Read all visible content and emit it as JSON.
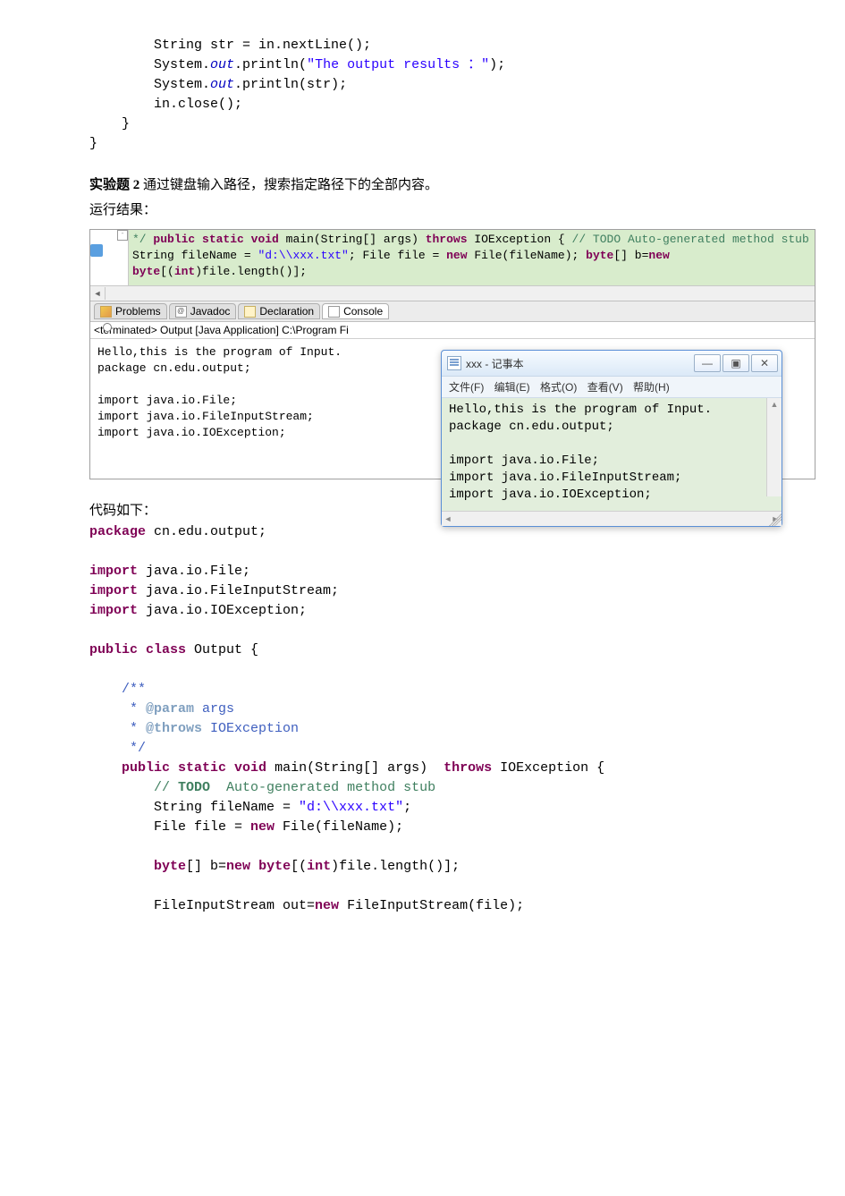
{
  "codeTop": {
    "l1a": "        String str = in.nextLine();",
    "l2a": "        System.",
    "l2b": "out",
    "l2c": ".println(",
    "l2d": "\"The output results ：\"",
    "l2e": ");",
    "l3a": "        System.",
    "l3b": "out",
    "l3c": ".println(str);",
    "l4": "        in.close();",
    "l5": "    }",
    "l6": "}"
  },
  "prose1_bold": "实验题 2",
  "prose1_rest": "  通过键盘输入路径，搜索指定路径下的全部内容。",
  "prose2": "运行结果：",
  "editor": {
    "l0": "         */",
    "l1a": "        ",
    "l1b": "public static void",
    "l1c": " main(String[] args) ",
    "l1d": "throws",
    "l1e": " IOException {",
    "l2a": "            ",
    "l2b": "// TODO Auto-generated method stub",
    "l3a": "            String fileName = ",
    "l3b": "\"d:\\\\xxx.txt\"",
    "l3c": ";",
    "l4a": "            File file = ",
    "l4b": "new",
    "l4c": " File(fileName);",
    "l5": "",
    "l6a": "            ",
    "l6b": "byte",
    "l6c": "[] b=",
    "l6d": "new byte",
    "l6e": "[(",
    "l6f": "int",
    "l6g": ")file.length()];"
  },
  "tabs": {
    "problems": "Problems",
    "javadoc": "Javadoc",
    "declaration": "Declaration",
    "console": "Console"
  },
  "terminated": "<terminated> Output [Java Application] C:\\Program Fi",
  "console_out": "Hello,this is the program of Input.\npackage cn.edu.output;\n\nimport java.io.File;\nimport java.io.FileInputStream;\nimport java.io.IOException;\n",
  "notepad": {
    "title": "xxx - 记事本",
    "menu": {
      "file": "文件(F)",
      "edit": "编辑(E)",
      "format": "格式(O)",
      "view": "查看(V)",
      "help": "帮助(H)"
    },
    "body": "Hello,this is the program of Input.\npackage cn.edu.output;\n\nimport java.io.File;\nimport java.io.FileInputStream;\nimport java.io.IOException;"
  },
  "prose3": "代码如下：",
  "codeBottom": {
    "pkg_kw": "package",
    "pkg_rest": " cn.edu.output;",
    "imp_kw": "import",
    "imp1": " java.io.File;",
    "imp2": " java.io.FileInputStream;",
    "imp3": " java.io.IOException;",
    "cls1": "public",
    "cls2": " class",
    "cls3": " Output {",
    "jd1": "    /**",
    "jd2a": "     * ",
    "jd2b": "@param",
    "jd2c": " args",
    "jd3a": "     * ",
    "jd3b": "@throws",
    "jd3c": " IOException",
    "jd4": "     */",
    "m1a": "    ",
    "m1b": "public",
    "m1c": " static",
    "m1d": " void",
    "m1e": " main(String[] args)  ",
    "m1f": "throws",
    "m1g": " IOException {",
    "m2a": "        ",
    "m2b": "// ",
    "m2c": "TODO",
    "m2d": "  Auto-generated method stub",
    "m3a": "        String fileName = ",
    "m3b": "\"d:\\\\xxx.txt\"",
    "m3c": ";",
    "m4a": "        File file = ",
    "m4b": "new",
    "m4c": " File(fileName);",
    "m5": "",
    "m6a": "        ",
    "m6b": "byte",
    "m6c": "[] b=",
    "m6d": "new",
    "m6e": " byte",
    "m6f": "[(",
    "m6g": "int",
    "m6h": ")file.length()];",
    "m7": "",
    "m8a": "        FileInputStream out=",
    "m8b": "new",
    "m8c": " FileInputStream(file);"
  }
}
